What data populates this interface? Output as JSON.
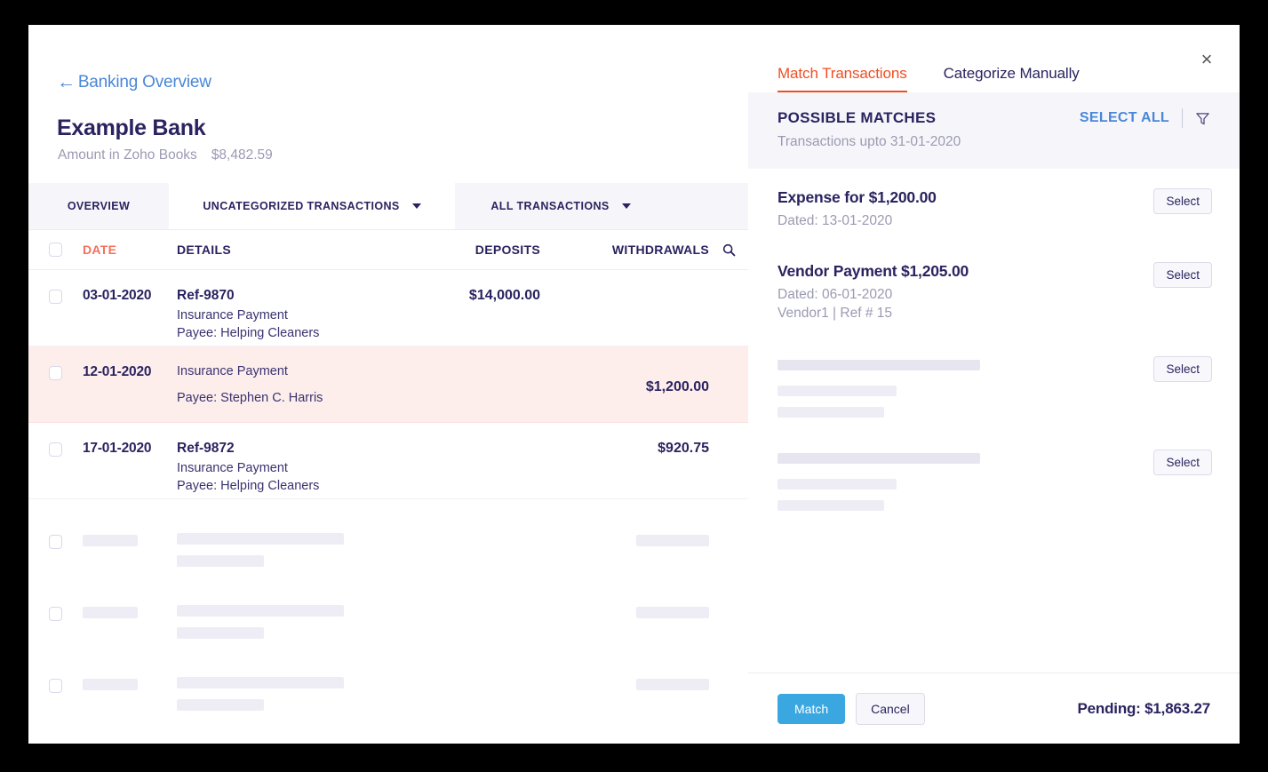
{
  "left": {
    "back_link": "Banking Overview",
    "bank_name": "Example Bank",
    "amount_label": "Amount in Zoho Books",
    "amount_value": "$8,482.59",
    "tabs": [
      {
        "label": "OVERVIEW",
        "active": false,
        "caret": false
      },
      {
        "label": "UNCATEGORIZED TRANSACTIONS",
        "active": true,
        "caret": true
      },
      {
        "label": "ALL TRANSACTIONS",
        "active": false,
        "caret": true
      }
    ],
    "columns": {
      "date": "DATE",
      "details": "DETAILS",
      "deposits": "DEPOSITS",
      "withdrawals": "WITHDRAWALS"
    },
    "rows": [
      {
        "date": "03-01-2020",
        "ref": "Ref-9870",
        "description": "Insurance Payment",
        "payee": "Payee: Helping Cleaners",
        "deposit": "$14,000.00",
        "withdrawal": "",
        "highlight": false
      },
      {
        "date": "12-01-2020",
        "ref": "",
        "description": "Insurance Payment",
        "payee": "Payee: Stephen C. Harris",
        "deposit": "",
        "withdrawal": "$1,200.00",
        "highlight": true
      },
      {
        "date": "17-01-2020",
        "ref": "Ref-9872",
        "description": "Insurance Payment",
        "payee": "Payee: Helping Cleaners",
        "deposit": "",
        "withdrawal": "$920.75",
        "highlight": false
      }
    ],
    "skeleton_row_count": 3
  },
  "right": {
    "tabs": [
      {
        "label": "Match Transactions",
        "active": true
      },
      {
        "label": "Categorize Manually",
        "active": false
      }
    ],
    "close_icon": "×",
    "section_title": "POSSIBLE MATCHES",
    "select_all": "SELECT ALL",
    "subtitle": "Transactions upto 31-01-2020",
    "matches": [
      {
        "title": "Expense for $1,200.00",
        "lines": [
          "Dated: 13-01-2020"
        ],
        "button": "Select"
      },
      {
        "title": "Vendor Payment $1,205.00",
        "lines": [
          "Dated: 06-01-2020",
          "Vendor1 | Ref # 15"
        ],
        "button": "Select"
      }
    ],
    "skeleton_matches": [
      {
        "button": "Select"
      },
      {
        "button": "Select"
      }
    ],
    "footer": {
      "match_button": "Match",
      "cancel_button": "Cancel",
      "pending": "Pending: $1,863.27"
    }
  },
  "colors": {
    "accent_orange": "#f04e23",
    "date_header": "#f4705b",
    "navy": "#2a2360",
    "link_blue": "#4a87d8",
    "button_blue": "#3ba7e0",
    "highlight_row": "#fdeeec",
    "muted": "#9b9ab3"
  }
}
